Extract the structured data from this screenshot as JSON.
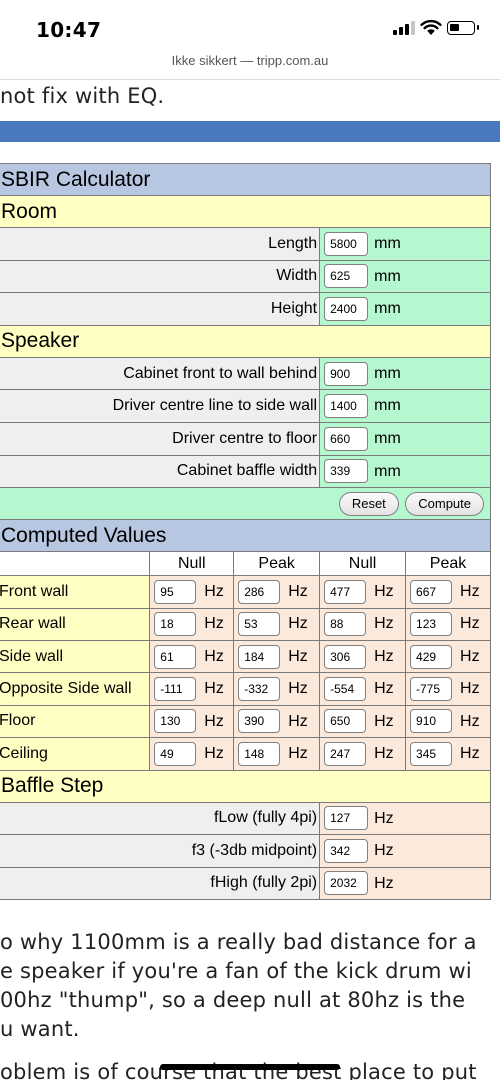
{
  "status": {
    "time": "10:47"
  },
  "browser": {
    "url_text": "Ikke sikkert — tripp.com.au"
  },
  "article": {
    "top_line": "not fix with EQ.",
    "bottom_lines": [
      "o why 1100mm is a really bad distance for a",
      "e speaker if you're a fan of the kick drum wi",
      "00hz \"thump\", so a deep null at 80hz is the",
      "u want.",
      "oblem is of course that the best place to put"
    ]
  },
  "calculator": {
    "title": "SBIR Calculator",
    "room": {
      "heading": "Room",
      "fields": [
        {
          "label": "Length",
          "value": "5800",
          "unit": "mm"
        },
        {
          "label": "Width",
          "value": "625",
          "unit": "mm"
        },
        {
          "label": "Height",
          "value": "2400",
          "unit": "mm"
        }
      ]
    },
    "speaker": {
      "heading": "Speaker",
      "fields": [
        {
          "label": "Cabinet front to wall behind",
          "value": "900",
          "unit": "mm"
        },
        {
          "label": "Driver centre line to side wall",
          "value": "1400",
          "unit": "mm"
        },
        {
          "label": "Driver centre to floor",
          "value": "660",
          "unit": "mm"
        },
        {
          "label": "Cabinet baffle width",
          "value": "339",
          "unit": "mm"
        }
      ],
      "reset_label": "Reset",
      "compute_label": "Compute"
    },
    "computed": {
      "heading": "Computed Values",
      "columns": [
        "Null",
        "Peak",
        "Null",
        "Peak"
      ],
      "unit": "Hz",
      "rows": [
        {
          "label": "Front wall",
          "values": [
            "95",
            "286",
            "477",
            "667"
          ]
        },
        {
          "label": "Rear wall",
          "values": [
            "18",
            "53",
            "88",
            "123"
          ]
        },
        {
          "label": "Side wall",
          "values": [
            "61",
            "184",
            "306",
            "429"
          ]
        },
        {
          "label": "Opposite Side wall",
          "values": [
            "-111",
            "-332",
            "-554",
            "-775"
          ]
        },
        {
          "label": "Floor",
          "values": [
            "130",
            "390",
            "650",
            "910"
          ]
        },
        {
          "label": "Ceiling",
          "values": [
            "49",
            "148",
            "247",
            "345"
          ]
        }
      ]
    },
    "baffle": {
      "heading": "Baffle Step",
      "fields": [
        {
          "label": "fLow (fully 4pi)",
          "value": "127",
          "unit": "Hz"
        },
        {
          "label": "f3 (-3db midpoint)",
          "value": "342",
          "unit": "Hz"
        },
        {
          "label": "fHigh (fully 2pi)",
          "value": "2032",
          "unit": "Hz"
        }
      ]
    }
  }
}
